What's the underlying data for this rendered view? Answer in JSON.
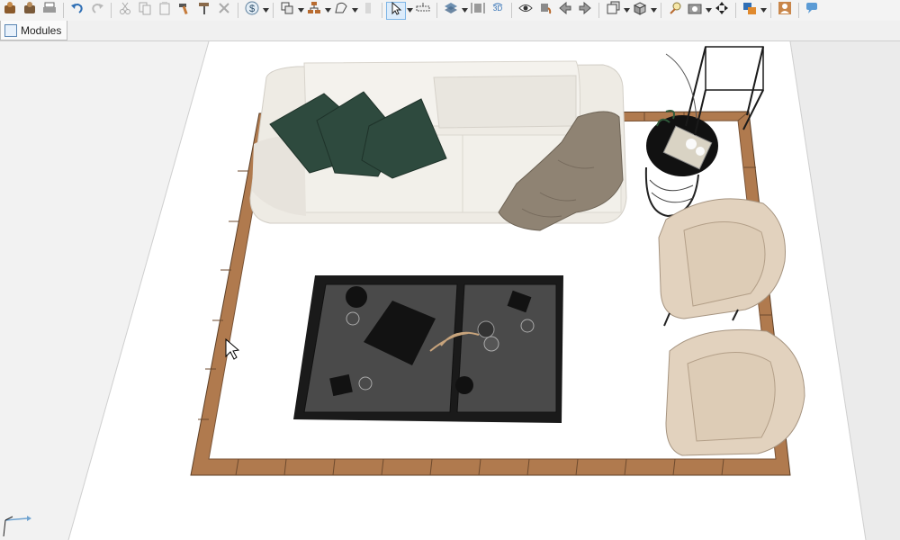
{
  "toolbar": {
    "buttons": [
      {
        "icon": "open-catalog-icon",
        "dropdown": false
      },
      {
        "icon": "catalog-box-icon",
        "dropdown": false
      },
      {
        "icon": "print-icon",
        "dropdown": false
      },
      {
        "sep": true
      },
      {
        "icon": "undo-icon",
        "dropdown": false
      },
      {
        "icon": "redo-icon",
        "dropdown": false
      },
      {
        "sep": true
      },
      {
        "icon": "cut-icon",
        "dropdown": false
      },
      {
        "icon": "copy-icon",
        "dropdown": false
      },
      {
        "icon": "paste-icon",
        "dropdown": false
      },
      {
        "icon": "hammer-icon",
        "dropdown": false
      },
      {
        "icon": "paint-roller-icon",
        "dropdown": false
      },
      {
        "icon": "delete-icon",
        "dropdown": false
      },
      {
        "sep": true
      },
      {
        "icon": "price-dollar-icon",
        "dropdown": true
      },
      {
        "sep": true
      },
      {
        "icon": "group-icon",
        "dropdown": true
      },
      {
        "icon": "layout-tree-icon",
        "dropdown": true
      },
      {
        "icon": "shape-curve-icon",
        "dropdown": true
      },
      {
        "icon": "panel-icon",
        "dropdown": false
      },
      {
        "sep": true
      },
      {
        "icon": "select-pointer-icon",
        "dropdown": true,
        "active": true
      },
      {
        "icon": "measure-icon",
        "dropdown": false
      },
      {
        "sep": true
      },
      {
        "icon": "layers-icon",
        "dropdown": true
      },
      {
        "icon": "dimension-icon",
        "dropdown": false
      },
      {
        "icon": "view-3d-icon",
        "dropdown": false
      },
      {
        "sep": true
      },
      {
        "icon": "eye-icon",
        "dropdown": false
      },
      {
        "icon": "paint-bucket-icon",
        "dropdown": false
      },
      {
        "icon": "arrow-left-icon",
        "dropdown": false
      },
      {
        "icon": "arrow-right-icon",
        "dropdown": false
      },
      {
        "sep": true
      },
      {
        "icon": "camera-view-icon",
        "dropdown": true
      },
      {
        "icon": "box-3d-icon",
        "dropdown": true
      },
      {
        "sep": true
      },
      {
        "icon": "light-bulb-icon",
        "dropdown": false
      },
      {
        "icon": "render-camera-icon",
        "dropdown": true
      },
      {
        "icon": "move-arrows-icon",
        "dropdown": false
      },
      {
        "sep": true
      },
      {
        "icon": "palette-icon",
        "dropdown": true
      },
      {
        "sep": true
      },
      {
        "icon": "user-profile-icon",
        "dropdown": false
      },
      {
        "sep": true
      },
      {
        "icon": "chat-icon",
        "dropdown": false
      }
    ]
  },
  "tabs": {
    "modules_label": "Modules"
  },
  "scene": {
    "floor_color": "#ffffff",
    "wall_color": "#f0f0f0",
    "rug_border_color": "#b07a4e",
    "sofa_color": "#eeebe4",
    "pillow_color": "#2e4a3e",
    "throw_color": "#8f8373",
    "armchair_color": "#e2d2be",
    "table_color": "#3d3d3d"
  }
}
